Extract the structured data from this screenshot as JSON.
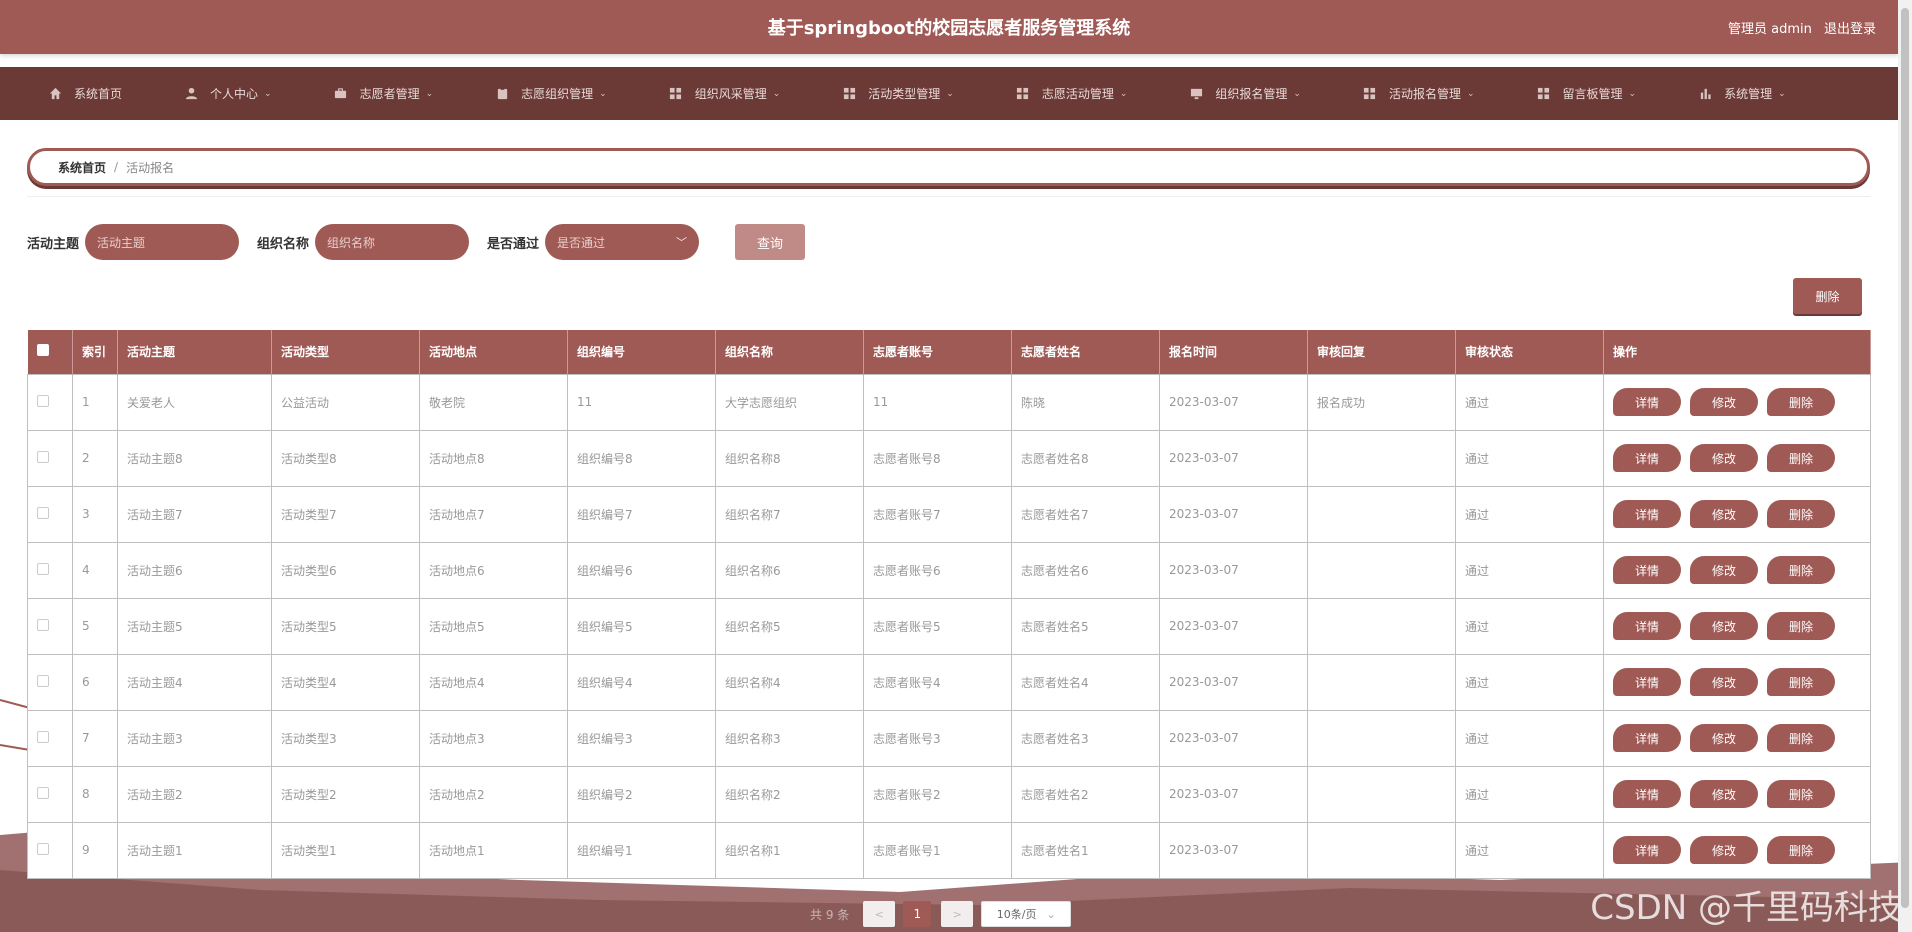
{
  "header": {
    "title": "基于springboot的校园志愿者服务管理系统",
    "user_label": "管理员 admin",
    "logout_label": "退出登录"
  },
  "nav": {
    "items": [
      {
        "label": "系统首页",
        "icon": "home-icon",
        "has_caret": false
      },
      {
        "label": "个人中心",
        "icon": "user-icon",
        "has_caret": true
      },
      {
        "label": "志愿者管理",
        "icon": "briefcase-icon",
        "has_caret": true
      },
      {
        "label": "志愿组织管理",
        "icon": "clipboard-icon",
        "has_caret": true
      },
      {
        "label": "组织风采管理",
        "icon": "grid-icon",
        "has_caret": true
      },
      {
        "label": "活动类型管理",
        "icon": "grid-icon",
        "has_caret": true
      },
      {
        "label": "志愿活动管理",
        "icon": "grid-icon",
        "has_caret": true
      },
      {
        "label": "组织报名管理",
        "icon": "monitor-icon",
        "has_caret": true
      },
      {
        "label": "活动报名管理",
        "icon": "grid-icon",
        "has_caret": true
      },
      {
        "label": "留言板管理",
        "icon": "grid-icon",
        "has_caret": true
      },
      {
        "label": "系统管理",
        "icon": "bar-chart-icon",
        "has_caret": true
      }
    ]
  },
  "breadcrumb": {
    "home": "系统首页",
    "separator": "/",
    "current": "活动报名"
  },
  "search": {
    "topic_label": "活动主题",
    "topic_placeholder": "活动主题",
    "org_label": "组织名称",
    "org_placeholder": "组织名称",
    "pass_label": "是否通过",
    "pass_placeholder": "是否通过",
    "query_label": "查询"
  },
  "actions": {
    "delete_label": "删除"
  },
  "table": {
    "headers": [
      "索引",
      "活动主题",
      "活动类型",
      "活动地点",
      "组织编号",
      "组织名称",
      "志愿者账号",
      "志愿者姓名",
      "报名时间",
      "审核回复",
      "审核状态",
      "操作"
    ],
    "rows": [
      [
        "1",
        "关爱老人",
        "公益活动",
        "敬老院",
        "11",
        "大学志愿组织",
        "11",
        "陈晓",
        "2023-03-07",
        "报名成功",
        "通过"
      ],
      [
        "2",
        "活动主题8",
        "活动类型8",
        "活动地点8",
        "组织编号8",
        "组织名称8",
        "志愿者账号8",
        "志愿者姓名8",
        "2023-03-07",
        "",
        "通过"
      ],
      [
        "3",
        "活动主题7",
        "活动类型7",
        "活动地点7",
        "组织编号7",
        "组织名称7",
        "志愿者账号7",
        "志愿者姓名7",
        "2023-03-07",
        "",
        "通过"
      ],
      [
        "4",
        "活动主题6",
        "活动类型6",
        "活动地点6",
        "组织编号6",
        "组织名称6",
        "志愿者账号6",
        "志愿者姓名6",
        "2023-03-07",
        "",
        "通过"
      ],
      [
        "5",
        "活动主题5",
        "活动类型5",
        "活动地点5",
        "组织编号5",
        "组织名称5",
        "志愿者账号5",
        "志愿者姓名5",
        "2023-03-07",
        "",
        "通过"
      ],
      [
        "6",
        "活动主题4",
        "活动类型4",
        "活动地点4",
        "组织编号4",
        "组织名称4",
        "志愿者账号4",
        "志愿者姓名4",
        "2023-03-07",
        "",
        "通过"
      ],
      [
        "7",
        "活动主题3",
        "活动类型3",
        "活动地点3",
        "组织编号3",
        "组织名称3",
        "志愿者账号3",
        "志愿者姓名3",
        "2023-03-07",
        "",
        "通过"
      ],
      [
        "8",
        "活动主题2",
        "活动类型2",
        "活动地点2",
        "组织编号2",
        "组织名称2",
        "志愿者账号2",
        "志愿者姓名2",
        "2023-03-07",
        "",
        "通过"
      ],
      [
        "9",
        "活动主题1",
        "活动类型1",
        "活动地点1",
        "组织编号1",
        "组织名称1",
        "志愿者账号1",
        "志愿者姓名1",
        "2023-03-07",
        "",
        "通过"
      ]
    ],
    "row_actions": {
      "detail": "详情",
      "edit": "修改",
      "delete": "删除"
    }
  },
  "pagination": {
    "total_text": "共 9 条",
    "prev": "<",
    "next": ">",
    "current_page": "1",
    "page_size": "10条/页"
  },
  "watermark": "CSDN @千里码科技",
  "colors": {
    "primary": "#a05a55",
    "dark": "#6b3a36"
  }
}
